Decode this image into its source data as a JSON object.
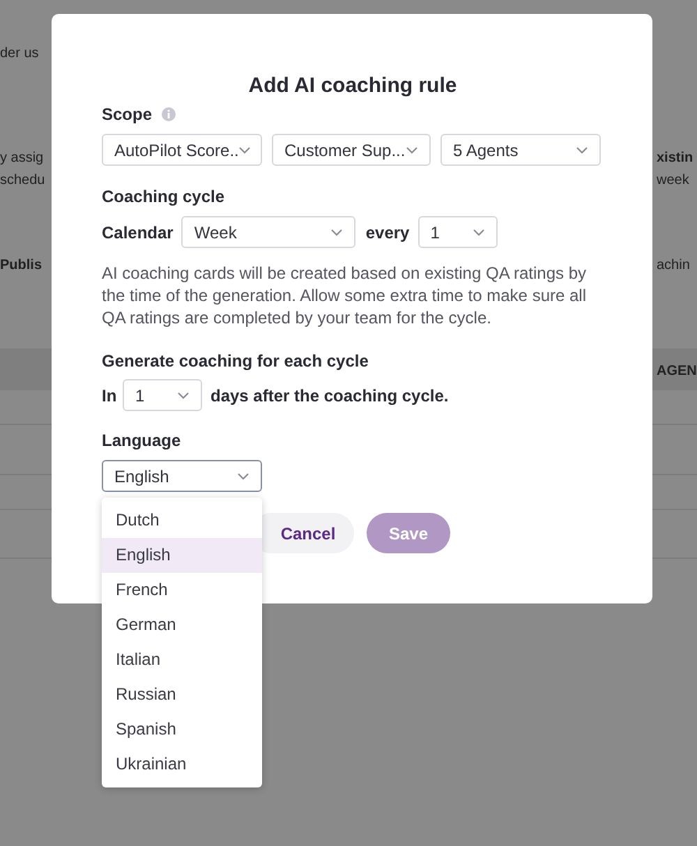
{
  "background_page": {
    "left_texts": [
      {
        "text": "der us",
        "bold": false
      },
      {
        "text": "y assig",
        "bold": false
      },
      {
        "text": "schedu",
        "bold": false
      },
      {
        "text": "Publis",
        "bold": true
      }
    ],
    "right_texts": [
      {
        "text": "xistin",
        "bold": true
      },
      {
        "text": "week",
        "bold": false
      },
      {
        "text": "achin",
        "bold": false
      }
    ],
    "table_header": "AGEN"
  },
  "dialog": {
    "title": "Add AI coaching rule",
    "scope": {
      "label": "Scope",
      "selects": [
        {
          "value": "AutoPilot Score.."
        },
        {
          "value": "Customer Sup..."
        },
        {
          "value": "5 Agents"
        }
      ]
    },
    "coaching_cycle": {
      "label": "Coaching cycle",
      "calendar_label": "Calendar",
      "calendar_value": "Week",
      "every_label": "every",
      "every_value": "1"
    },
    "description": "AI coaching cards will be created based on existing QA ratings by the time of the generation. Allow some extra time to make sure all QA ratings are completed by your team for the cycle.",
    "generate": {
      "label": "Generate coaching for each cycle",
      "prefix": "In",
      "days_value": "1",
      "suffix": "days after the coaching cycle."
    },
    "language": {
      "label": "Language",
      "value": "English",
      "expanded": true,
      "options": [
        {
          "label": "Dutch",
          "selected": false
        },
        {
          "label": "English",
          "selected": true
        },
        {
          "label": "French",
          "selected": false
        },
        {
          "label": "German",
          "selected": false
        },
        {
          "label": "Italian",
          "selected": false
        },
        {
          "label": "Russian",
          "selected": false
        },
        {
          "label": "Spanish",
          "selected": false
        },
        {
          "label": "Ukrainian",
          "selected": false
        }
      ]
    },
    "buttons": [
      {
        "label": "Cancel",
        "kind": "secondary"
      },
      {
        "label": "Save",
        "kind": "primary"
      }
    ]
  }
}
